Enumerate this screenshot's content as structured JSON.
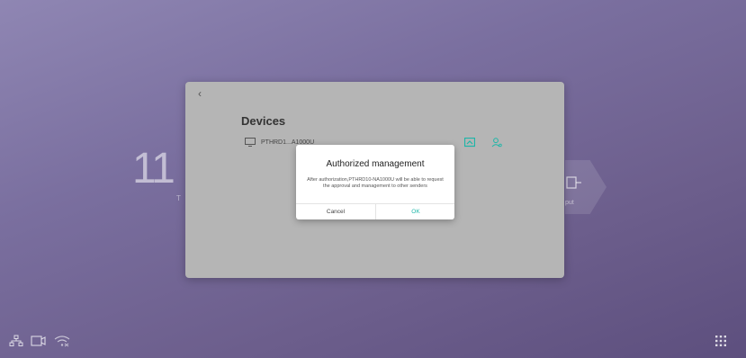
{
  "background": {
    "clock_partial": "11",
    "clock_sub_partial": "T",
    "input_label_partial": "put"
  },
  "panel": {
    "back_symbol": "‹",
    "title": "Devices",
    "device_name": "PTHRD1...A1000U"
  },
  "dialog": {
    "title": "Authorized management",
    "message": "After authorization,PTHRD10-NA1000U will be able to request the approval and management to other senders",
    "cancel_label": "Cancel",
    "ok_label": "OK"
  },
  "colors": {
    "accent": "#1cb6a8",
    "panel_bg": "#b5b5b5"
  }
}
